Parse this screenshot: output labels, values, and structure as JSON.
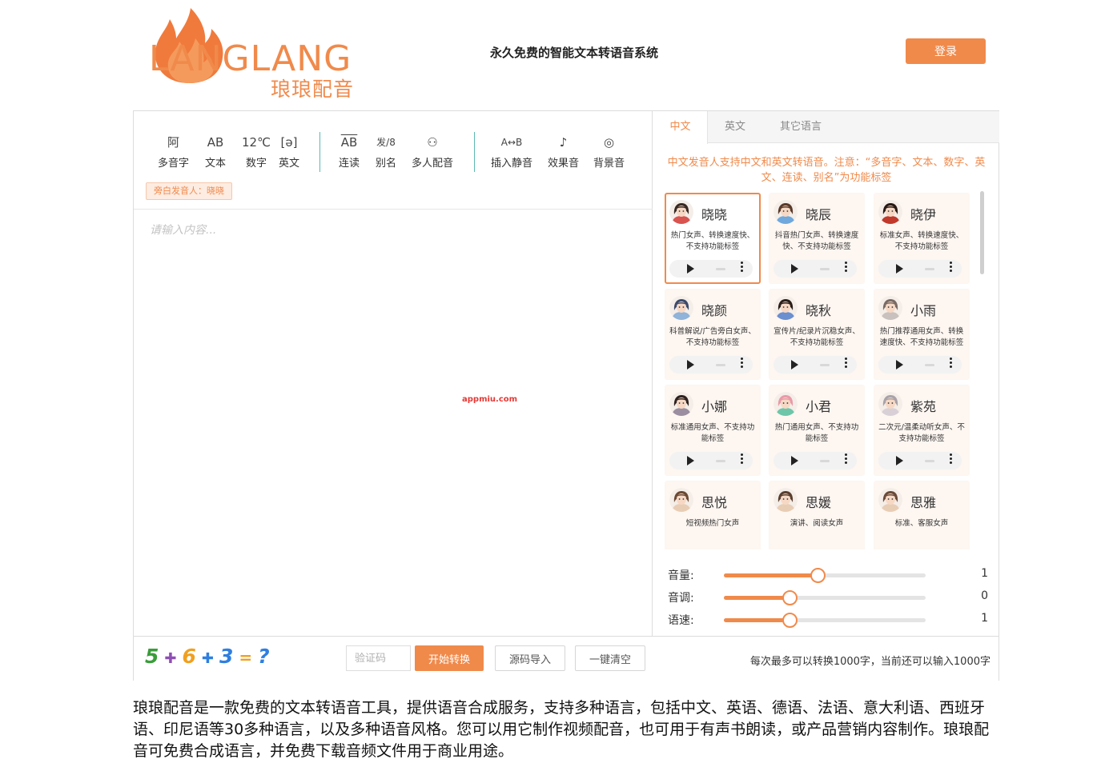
{
  "brand": {
    "wordmark": "LANGLANG",
    "subtitle": "琅琅配音",
    "colors": {
      "accent": "#f08a4b",
      "teal": "#5cb8b2"
    }
  },
  "header": {
    "site_title": "永久免费的智能文本转语音系统",
    "login_label": "登录"
  },
  "toolbar": {
    "groups": [
      [
        {
          "icon": "阿",
          "label": "多音字",
          "icon_name": "polyphone-icon"
        },
        {
          "icon": "AB",
          "label": "文本",
          "icon_name": "text-icon"
        },
        {
          "icon": "12℃",
          "label": "数字",
          "icon_name": "number-icon"
        },
        {
          "icon": "[ə]",
          "label": "英文",
          "icon_name": "phonetic-icon"
        }
      ],
      [
        {
          "icon": "AB",
          "label": "连读",
          "icon_name": "liaison-icon"
        },
        {
          "icon": "发/8",
          "label": "别名",
          "icon_name": "alias-icon"
        },
        {
          "icon": "⚇",
          "label": "多人配音",
          "icon_name": "multi-voice-icon"
        }
      ],
      [
        {
          "icon": "A↔B",
          "label": "插入静音",
          "icon_name": "insert-silence-icon"
        },
        {
          "icon": "♪",
          "label": "效果音",
          "icon_name": "sound-effect-icon"
        },
        {
          "icon": "◎",
          "label": "背景音",
          "icon_name": "background-music-icon"
        }
      ]
    ],
    "narrator_tag": "旁白发音人：晓晓"
  },
  "editor": {
    "placeholder": "请输入内容...",
    "value": "",
    "watermark": "appmiu.com"
  },
  "bottom": {
    "captcha_glyphs": [
      "5",
      "✚",
      "6",
      "✚",
      "3",
      "=",
      "?"
    ],
    "captcha_colors": [
      "#3a9d3a",
      "#8e4fb5",
      "#f0a020",
      "#2f7fe0",
      "#2f7fe0",
      "#f0a020",
      "#2f7fe0"
    ],
    "code_placeholder": "验证码",
    "start_label": "开始转换",
    "import_label": "源码导入",
    "clear_label": "一键清空",
    "limit_text": "每次最多可以转换1000字，当前还可以输入1000字"
  },
  "panel": {
    "tabs": [
      {
        "label": "中文",
        "active": true
      },
      {
        "label": "英文",
        "active": false
      },
      {
        "label": "其它语言",
        "active": false
      }
    ],
    "notice": "中文发音人支持中文和英文转语音。注意：“多音字、文本、数字、英文、连读、别名”为功能标签",
    "voices": [
      {
        "name": "晓晓",
        "desc": "热门女声、转换速度快、不支持功能标签",
        "selected": true,
        "hair": "#3a2a24",
        "shirt": "#d9534f"
      },
      {
        "name": "晓辰",
        "desc": "抖音热门女声、转换速度快、不支持功能标签",
        "selected": false,
        "hair": "#5a3a2a",
        "shirt": "#6fa8dc"
      },
      {
        "name": "晓伊",
        "desc": "标准女声、转换速度快、不支持功能标签",
        "selected": false,
        "hair": "#2a1a14",
        "shirt": "#c0392b"
      },
      {
        "name": "晓颜",
        "desc": "科普解说/广告旁白女声、不支持功能标签",
        "selected": false,
        "hair": "#3c4a6a",
        "shirt": "#8fb3d9"
      },
      {
        "name": "晓秋",
        "desc": "宣传片/纪录片沉稳女声、不支持功能标签",
        "selected": false,
        "hair": "#2a1f1a",
        "shirt": "#6b8fcf"
      },
      {
        "name": "小雨",
        "desc": "热门推荐通用女声、转换速度快、不支持功能标签",
        "selected": false,
        "hair": "#7a6a64",
        "shirt": "#c9c1bd"
      },
      {
        "name": "小娜",
        "desc": "标准通用女声、不支持功能标签",
        "selected": false,
        "hair": "#2e2220",
        "shirt": "#9b8ea0"
      },
      {
        "name": "小君",
        "desc": "热门通用女声、不支持功能标签",
        "selected": false,
        "hair": "#e99aa8",
        "shirt": "#6ec6a9"
      },
      {
        "name": "紫苑",
        "desc": "二次元/温柔动听女声、不支持功能标签",
        "selected": false,
        "hair": "#a9a2a8",
        "shirt": "#d8d0d6"
      },
      {
        "name": "思悦",
        "desc": "短视频热门女声",
        "selected": false,
        "hair": "#6b4a34",
        "shirt": "#e8cdb5",
        "no_player": true
      },
      {
        "name": "思媛",
        "desc": "演讲、阅读女声",
        "selected": false,
        "hair": "#5a3e2e",
        "shirt": "#e8cdb5",
        "no_player": true
      },
      {
        "name": "思雅",
        "desc": "标准、客服女声",
        "selected": false,
        "hair": "#6a4a38",
        "shirt": "#e8cdb5",
        "no_player": true
      }
    ],
    "sliders": [
      {
        "label": "音量:",
        "value": "1",
        "level": 0.47
      },
      {
        "label": "音调:",
        "value": "0",
        "level": 0.33
      },
      {
        "label": "语速:",
        "value": "1",
        "level": 0.33
      }
    ]
  },
  "description": "琅琅配音是一款免费的文本转语音工具，提供语音合成服务，支持多种语言，包括中文、英语、德语、法语、意大利语、西班牙语、印尼语等30多种语言，以及多种语音风格。您可以用它制作视频配音，也可用于有声书朗读，或产品营销内容制作。琅琅配音可免费合成语言，并免费下载音频文件用于商业用途。"
}
